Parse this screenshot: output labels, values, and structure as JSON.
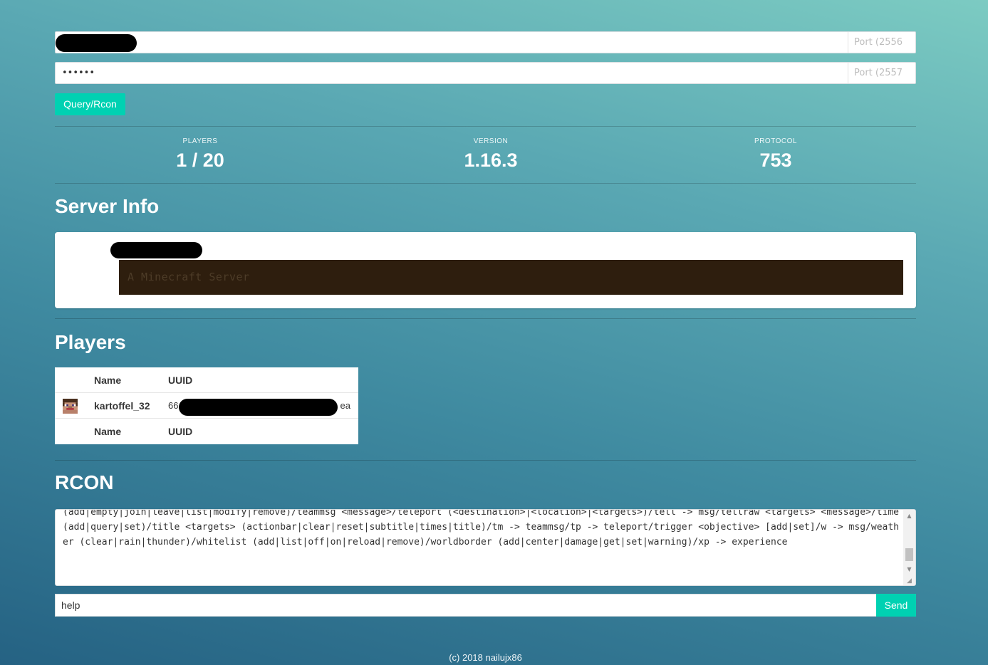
{
  "connect": {
    "address_port_placeholder": "Port (2556",
    "password_value": "••••••",
    "rcon_port_placeholder": "Port (2557",
    "button_label": "Query/Rcon"
  },
  "stats": [
    {
      "label": "PLAYERS",
      "value": "1 / 20"
    },
    {
      "label": "VERSION",
      "value": "1.16.3"
    },
    {
      "label": "PROTOCOL",
      "value": "753"
    }
  ],
  "server_info": {
    "heading": "Server Info",
    "motd": "A Minecraft Server"
  },
  "players": {
    "heading": "Players",
    "columns": [
      "Name",
      "UUID"
    ],
    "rows": [
      {
        "name": "kartoffel_32",
        "uuid_prefix": "66",
        "uuid_suffix": "ea"
      }
    ],
    "footer_columns": [
      "Name",
      "UUID"
    ]
  },
  "rcon": {
    "heading": "RCON",
    "output": "(add|empty|join|leave|list|modify|remove)/teammsg <message>/teleport (<destination>|<location>|<targets>)/tell -> msg/tellraw <targets> <message>/time (add|query|set)/title <targets> (actionbar|clear|reset|subtitle|times|title)/tm -> teammsg/tp -> teleport/trigger <objective> [add|set]/w -> msg/weather (clear|rain|thunder)/whitelist (add|list|off|on|reload|remove)/worldborder (add|center|damage|get|set|warning)/xp -> experience",
    "command_value": "help",
    "send_label": "Send"
  },
  "footer": "(c) 2018 nailujx86",
  "colors": {
    "accent": "#00d1b2",
    "motd_background": "#2e1e0e"
  }
}
